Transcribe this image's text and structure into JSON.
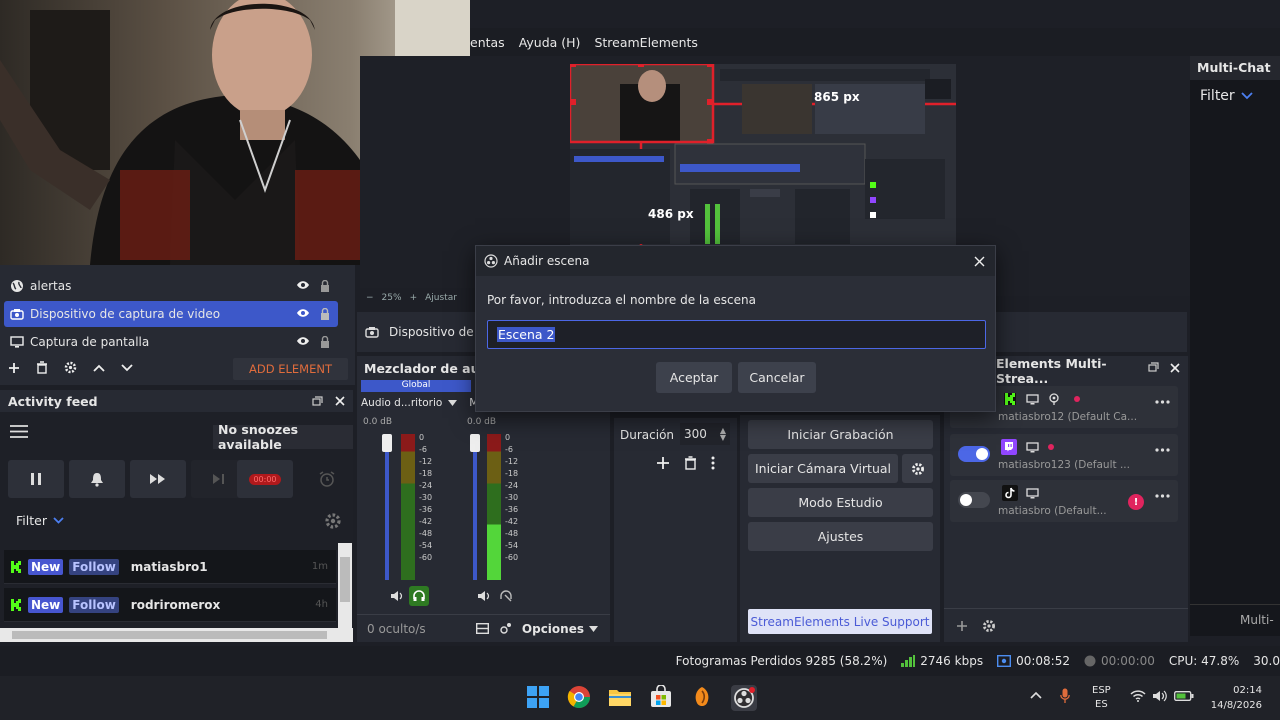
{
  "menubar": {
    "items": [
      "entas",
      "Ayuda (H)",
      "StreamElements"
    ]
  },
  "preview": {
    "measure_w": "865 px",
    "measure_h": "486 px",
    "zoom": "25%",
    "adjust": "Ajustar"
  },
  "multichat": {
    "title": "Multi-Chat",
    "filter": "Filter",
    "footer": "Multi-"
  },
  "sources": {
    "items": [
      {
        "label": "alertas",
        "icon": "globe-icon"
      },
      {
        "label": "Dispositivo de captura de video",
        "icon": "camera-icon",
        "selected": true
      },
      {
        "label": "Captura de pantalla",
        "icon": "monitor-icon"
      }
    ],
    "add_element": "ADD ELEMENT"
  },
  "props_bar": {
    "label": "Dispositivo de c"
  },
  "activity": {
    "title": "Activity feed",
    "snooze": "No snoozes available",
    "timer": "00:00",
    "filter": "Filter",
    "rows": [
      {
        "new": "New",
        "follow": "Follow",
        "user": "matiasbro1",
        "time": "1m"
      },
      {
        "new": "New",
        "follow": "Follow",
        "user": "rodriromerox",
        "time": "4h"
      }
    ]
  },
  "mixer": {
    "title": "Mezclador de audi",
    "global": "Global",
    "ch1": "Audio d...ritorio",
    "ch2": "Mi",
    "db1": "0.0 dB",
    "db2": "0.0 dB",
    "scale": [
      "0",
      "-6",
      "-12",
      "-18",
      "-24",
      "-30",
      "-36",
      "-42",
      "-48",
      "-54",
      "-60"
    ],
    "hidden": "0 oculto/s",
    "options": "Opciones"
  },
  "transitions": {
    "duration_label": "Duración",
    "duration_value": "300"
  },
  "controls": {
    "start_recording": "Iniciar Grabación",
    "start_virtual_cam": "Iniciar Cámara Virtual",
    "studio_mode": "Modo Estudio",
    "settings": "Ajustes",
    "live_support": "StreamElements Live Support"
  },
  "multistream": {
    "title": "Elements Multi-Strea...",
    "rows": [
      {
        "platform": "kick",
        "name": "matiasbro12 (Default Ca...",
        "enabled": true
      },
      {
        "platform": "twitch",
        "name": "matiasbro123 (Default ...",
        "enabled": true
      },
      {
        "platform": "tiktok",
        "name": "matiasbro (Default...",
        "enabled": false
      }
    ]
  },
  "status": {
    "dropped": "Fotogramas Perdidos 9285 (58.2%)",
    "bitrate": "2746 kbps",
    "stream_time": "00:08:52",
    "rec_time": "00:00:00",
    "cpu": "CPU: 47.8%",
    "fps": "30.0"
  },
  "taskbar": {
    "lang1": "ESP",
    "lang2": "ES",
    "time": "02:14",
    "date": "14/8/2026"
  },
  "dialog": {
    "title": "Añadir escena",
    "prompt": "Por favor, introduzca el nombre de la escena",
    "value": "Escena 2",
    "ok": "Aceptar",
    "cancel": "Cancelar"
  },
  "colors": {
    "accent": "#3d58c9",
    "kick": "#53fc18",
    "twitch": "#9146ff",
    "danger": "#e0245e"
  }
}
